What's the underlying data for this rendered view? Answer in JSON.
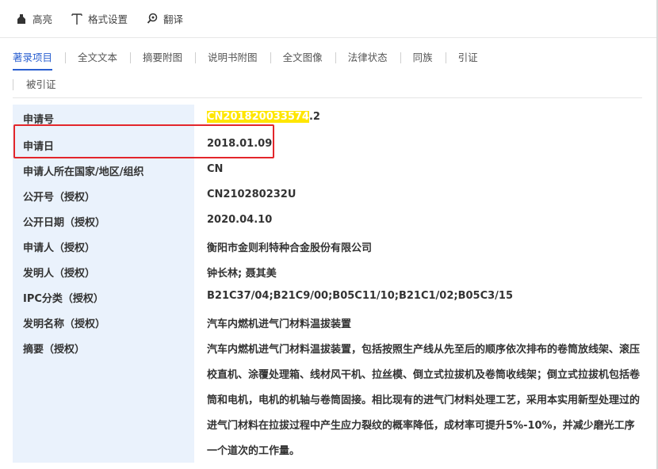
{
  "toolbar": {
    "highlight_label": "高亮",
    "format_label": "格式设置",
    "translate_label": "翻译"
  },
  "tabs": [
    {
      "label": "著录项目",
      "active": true
    },
    {
      "label": "全文文本"
    },
    {
      "label": "摘要附图"
    },
    {
      "label": "说明书附图"
    },
    {
      "label": "全文图像"
    },
    {
      "label": "法律状态"
    },
    {
      "label": "同族"
    },
    {
      "label": "引证"
    },
    {
      "label": "被引证"
    }
  ],
  "fields": {
    "app_no_label": "申请号",
    "app_no_highlight": "CN201820033574",
    "app_no_suffix": ".2",
    "app_date_label": "申请日",
    "app_date_value": "2018.01.09",
    "country_label": "申请人所在国家/地区/组织",
    "country_value": "CN",
    "pub_no_label": "公开号（授权）",
    "pub_no_value": "CN210280232U",
    "pub_date_label": "公开日期（授权）",
    "pub_date_value": "2020.04.10",
    "applicant_label": "申请人（授权）",
    "applicant_value": "衡阳市金则利特种合金股份有限公司",
    "inventor_label": "发明人（授权）",
    "inventor_value": "钟长林; 聂其美",
    "ipc_label": "IPC分类（授权）",
    "ipc_value": "B21C37/04;B21C9/00;B05C11/10;B21C1/02;B05C3/15",
    "title_label": "发明名称（授权）",
    "title_value": "汽车内燃机进气门材料温拔装置",
    "abstract_label": "摘要（授权）",
    "abstract_value": "汽车内燃机进气门材料温拔装置，包括按照生产线从先至后的顺序依次排布的卷筒放线架、滚压校直机、涂覆处理箱、线材风干机、拉丝模、倒立式拉拔机及卷筒收线架；倒立式拉拔机包括卷筒和电机，电机的机轴与卷筒固接。相比现有的进气门材料处理工艺，采用本实用新型处理过的进气门材料在拉拔过程中产生应力裂纹的概率降低，成材率可提升5%-10%，并减少磨光工序一个道次的工作量。"
  },
  "colors": {
    "accent": "#2a5fd0",
    "highlight": "#ffe600",
    "annotation_box": "#e3262b",
    "label_bg": "#eaf2fc"
  }
}
